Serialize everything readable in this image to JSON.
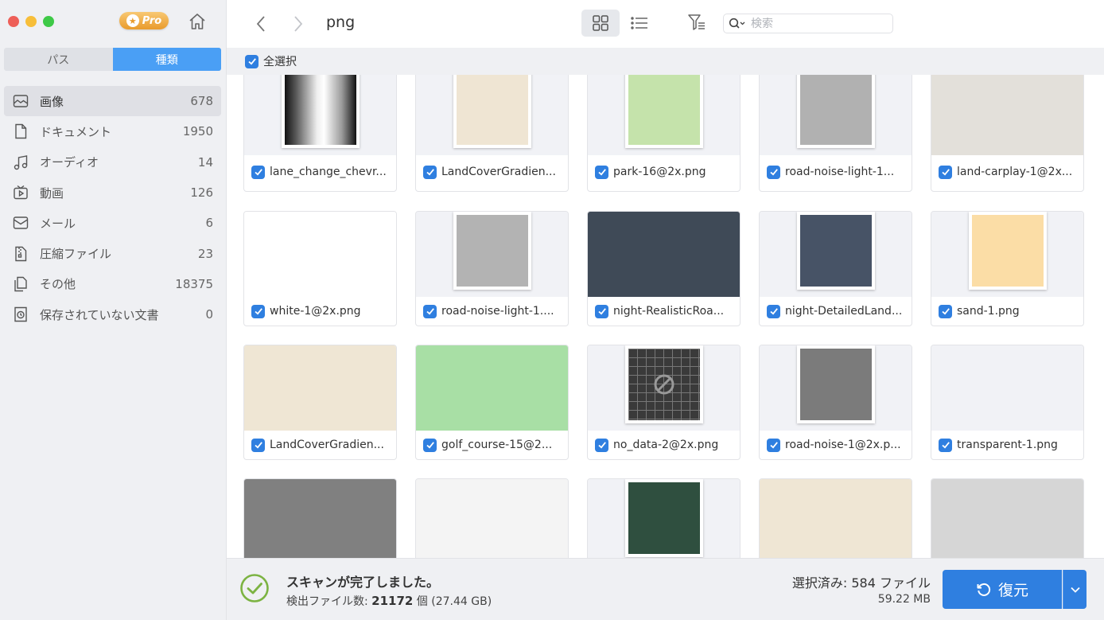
{
  "sidebar": {
    "pro_label": "Pro",
    "tabs": [
      {
        "label": "パス",
        "active": false
      },
      {
        "label": "種類",
        "active": true
      }
    ],
    "categories": [
      {
        "label": "画像",
        "count": "678",
        "icon": "image-icon",
        "active": true
      },
      {
        "label": "ドキュメント",
        "count": "1950",
        "icon": "document-icon",
        "active": false
      },
      {
        "label": "オーディオ",
        "count": "14",
        "icon": "music-icon",
        "active": false
      },
      {
        "label": "動画",
        "count": "126",
        "icon": "video-icon",
        "active": false
      },
      {
        "label": "メール",
        "count": "6",
        "icon": "mail-icon",
        "active": false
      },
      {
        "label": "圧縮ファイル",
        "count": "23",
        "icon": "archive-icon",
        "active": false
      },
      {
        "label": "その他",
        "count": "18375",
        "icon": "other-files-icon",
        "active": false
      },
      {
        "label": "保存されていない文書",
        "count": "0",
        "icon": "unsaved-doc-icon",
        "active": false
      }
    ]
  },
  "topbar": {
    "folder_title": "png",
    "search_placeholder": "検索"
  },
  "selectbar": {
    "select_all_label": "全選択"
  },
  "files": [
    {
      "name": "lane_change_chevr...",
      "thumb": "gradient-chevron",
      "bg": "#ffffff"
    },
    {
      "name": "LandCoverGradien...",
      "thumb": "square",
      "bg": "#efe5d3"
    },
    {
      "name": "park-16@2x.png",
      "thumb": "square",
      "bg": "#c5e3ab"
    },
    {
      "name": "road-noise-light-1...",
      "thumb": "square",
      "bg": "#b1b1b1"
    },
    {
      "name": "land-carplay-1@2x...",
      "thumb": "fill",
      "bg": "#e3e0da"
    },
    {
      "name": "white-1@2x.png",
      "thumb": "fill",
      "bg": "#ffffff"
    },
    {
      "name": "road-noise-light-1....",
      "thumb": "square",
      "bg": "#b3b3b3"
    },
    {
      "name": "night-RealisticRoa...",
      "thumb": "fill",
      "bg": "#3f4a57"
    },
    {
      "name": "night-DetailedLand...",
      "thumb": "square",
      "bg": "#475366"
    },
    {
      "name": "sand-1.png",
      "thumb": "square",
      "bg": "#fbdda6"
    },
    {
      "name": "LandCoverGradien...",
      "thumb": "fill",
      "bg": "#efe6d4"
    },
    {
      "name": "golf_course-15@2...",
      "thumb": "fill",
      "bg": "#a8dfa5"
    },
    {
      "name": "no_data-2@2x.png",
      "thumb": "nodata",
      "bg": "#3a3a3a"
    },
    {
      "name": "road-noise-1@2x.p...",
      "thumb": "square",
      "bg": "#7b7b7b"
    },
    {
      "name": "transparent-1.png",
      "thumb": "fill",
      "bg": "#f1f2f6"
    },
    {
      "name": "",
      "thumb": "fill",
      "bg": "#808080"
    },
    {
      "name": "",
      "thumb": "fill",
      "bg": "#f4f4f4"
    },
    {
      "name": "",
      "thumb": "square",
      "bg": "#2f4f3f"
    },
    {
      "name": "",
      "thumb": "fill",
      "bg": "#efe6d4"
    },
    {
      "name": "",
      "thumb": "fill",
      "bg": "#d6d6d6"
    }
  ],
  "status": {
    "title": "スキャンが完了しました。",
    "detail_prefix": "検出ファイル数: ",
    "detail_count": "21172",
    "detail_suffix": " 個 (27.44 GB)",
    "selected_label": "選択済み: 584 ファイル",
    "selected_size": "59.22 MB",
    "recover_label": "復元"
  },
  "colors": {
    "accent": "#2f7fe0",
    "segment_active": "#4a9ff5",
    "success": "#7cb342"
  }
}
